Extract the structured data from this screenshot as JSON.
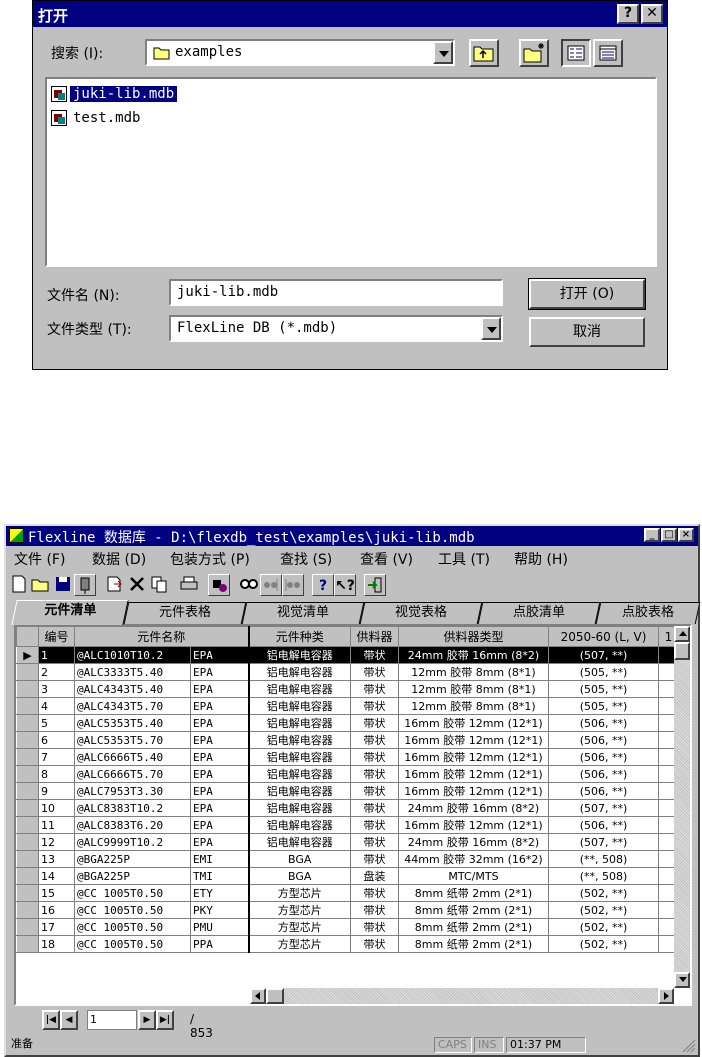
{
  "open_dialog": {
    "title": "打开",
    "help_glyph": "?",
    "close_glyph": "✕",
    "search_label": "搜索 (I):",
    "location": "examples",
    "files": [
      "juki-lib.mdb",
      "test.mdb"
    ],
    "filename_label": "文件名 (N):",
    "filename_value": "juki-lib.mdb",
    "filetype_label": "文件类型 (T):",
    "filetype_value": "FlexLine DB (*.mdb)",
    "open_button": "打开 (O)",
    "cancel_button": "取消"
  },
  "main_window": {
    "title": "Flexline 数据库 - D:\\flexdb_test\\examples\\juki-lib.mdb",
    "menu": [
      "文件 (F)",
      "数据 (D)",
      "包装方式 (P)",
      "查找 (S)",
      "查看 (V)",
      "工具 (T)",
      "帮助 (H)"
    ],
    "tabs": [
      "元件清单",
      "元件表格",
      "视觉清单",
      "视觉表格",
      "点胶清单",
      "点胶表格"
    ],
    "columns": [
      "编号",
      "元件名称",
      "元件种类",
      "供料器",
      "供料器类型",
      "2050-60 (L, V)",
      "1"
    ],
    "rows": [
      {
        "id": "1",
        "name": "@ALC1010T10.2",
        "suffix": "EPA",
        "kind": "铝电解电容器",
        "feeder": "带状",
        "feeder_type": "24mm 胶带 16mm (8*2)",
        "pos": "(507, **)"
      },
      {
        "id": "2",
        "name": "@ALC3333T5.40",
        "suffix": "EPA",
        "kind": "铝电解电容器",
        "feeder": "带状",
        "feeder_type": "12mm 胶带 8mm (8*1)",
        "pos": "(505, **)"
      },
      {
        "id": "3",
        "name": "@ALC4343T5.40",
        "suffix": "EPA",
        "kind": "铝电解电容器",
        "feeder": "带状",
        "feeder_type": "12mm 胶带 8mm (8*1)",
        "pos": "(505, **)"
      },
      {
        "id": "4",
        "name": "@ALC4343T5.70",
        "suffix": "EPA",
        "kind": "铝电解电容器",
        "feeder": "带状",
        "feeder_type": "12mm 胶带 8mm (8*1)",
        "pos": "(505, **)"
      },
      {
        "id": "5",
        "name": "@ALC5353T5.40",
        "suffix": "EPA",
        "kind": "铝电解电容器",
        "feeder": "带状",
        "feeder_type": "16mm 胶带 12mm (12*1)",
        "pos": "(506, **)"
      },
      {
        "id": "6",
        "name": "@ALC5353T5.70",
        "suffix": "EPA",
        "kind": "铝电解电容器",
        "feeder": "带状",
        "feeder_type": "16mm 胶带 12mm (12*1)",
        "pos": "(506, **)"
      },
      {
        "id": "7",
        "name": "@ALC6666T5.40",
        "suffix": "EPA",
        "kind": "铝电解电容器",
        "feeder": "带状",
        "feeder_type": "16mm 胶带 12mm (12*1)",
        "pos": "(506, **)"
      },
      {
        "id": "8",
        "name": "@ALC6666T5.70",
        "suffix": "EPA",
        "kind": "铝电解电容器",
        "feeder": "带状",
        "feeder_type": "16mm 胶带 12mm (12*1)",
        "pos": "(506, **)"
      },
      {
        "id": "9",
        "name": "@ALC7953T3.30",
        "suffix": "EPA",
        "kind": "铝电解电容器",
        "feeder": "带状",
        "feeder_type": "16mm 胶带 12mm (12*1)",
        "pos": "(506, **)"
      },
      {
        "id": "10",
        "name": "@ALC8383T10.2",
        "suffix": "EPA",
        "kind": "铝电解电容器",
        "feeder": "带状",
        "feeder_type": "24mm 胶带 16mm (8*2)",
        "pos": "(507, **)"
      },
      {
        "id": "11",
        "name": "@ALC8383T6.20",
        "suffix": "EPA",
        "kind": "铝电解电容器",
        "feeder": "带状",
        "feeder_type": "16mm 胶带 12mm (12*1)",
        "pos": "(506, **)"
      },
      {
        "id": "12",
        "name": "@ALC9999T10.2",
        "suffix": "EPA",
        "kind": "铝电解电容器",
        "feeder": "带状",
        "feeder_type": "24mm 胶带 16mm (8*2)",
        "pos": "(507, **)"
      },
      {
        "id": "13",
        "name": "@BGA225P",
        "suffix": "EMI",
        "kind": "BGA",
        "feeder": "带状",
        "feeder_type": "44mm 胶带 32mm (16*2)",
        "pos": "(**, 508)"
      },
      {
        "id": "14",
        "name": "@BGA225P",
        "suffix": "TMI",
        "kind": "BGA",
        "feeder": "盘装",
        "feeder_type": "MTC/MTS",
        "pos": "(**, 508)"
      },
      {
        "id": "15",
        "name": "@CC 1005T0.50",
        "suffix": "ETY",
        "kind": "方型芯片",
        "feeder": "带状",
        "feeder_type": "8mm 纸带 2mm (2*1)",
        "pos": "(502, **)"
      },
      {
        "id": "16",
        "name": "@CC 1005T0.50",
        "suffix": "PKY",
        "kind": "方型芯片",
        "feeder": "带状",
        "feeder_type": "8mm 纸带 2mm (2*1)",
        "pos": "(502, **)"
      },
      {
        "id": "17",
        "name": "@CC 1005T0.50",
        "suffix": "PMU",
        "kind": "方型芯片",
        "feeder": "带状",
        "feeder_type": "8mm 纸带 2mm (2*1)",
        "pos": "(502, **)"
      },
      {
        "id": "18",
        "name": "@CC 1005T0.50",
        "suffix": "PPA",
        "kind": "方型芯片",
        "feeder": "带状",
        "feeder_type": "8mm 纸带 2mm (2*1)",
        "pos": "(502, **)"
      }
    ],
    "nav_record": "1",
    "nav_total": "/ 853",
    "status_text": "准备",
    "status_caps": "CAPS",
    "status_ins": "INS",
    "status_time": "01:37 PM"
  },
  "colors": {
    "title_bar": "#000080",
    "face": "#c0c0c0",
    "selection": "#000000"
  }
}
